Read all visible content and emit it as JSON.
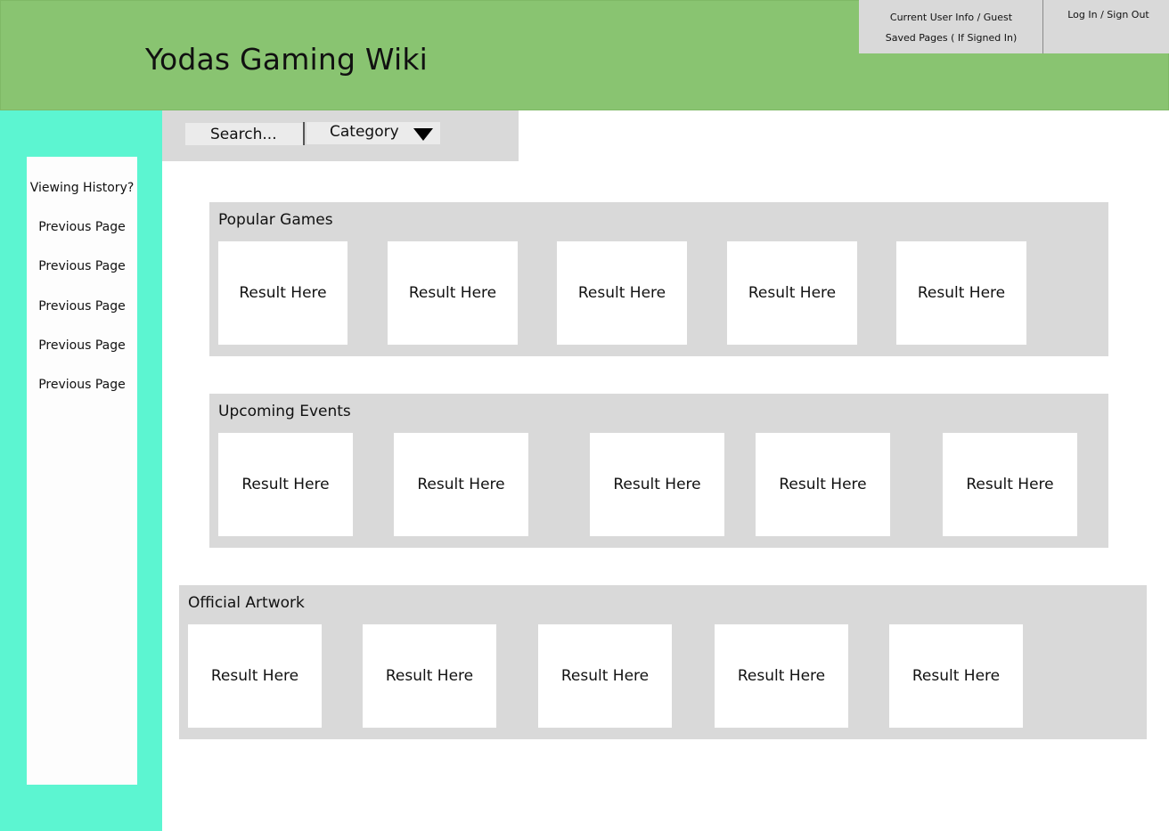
{
  "header": {
    "title": "Yodas Gaming Wiki",
    "user_info": "Current User Info / Guest",
    "saved_pages": "Saved Pages ( If Signed In)",
    "login": "Log In / Sign Out"
  },
  "sidebar": {
    "history_title": "Viewing History?",
    "items": [
      {
        "label": "Previous Page"
      },
      {
        "label": "Previous Page"
      },
      {
        "label": "Previous Page"
      },
      {
        "label": "Previous Page"
      },
      {
        "label": "Previous Page"
      }
    ]
  },
  "search": {
    "placeholder": "Search...",
    "category": "Category"
  },
  "sections": [
    {
      "title": "Popular Games",
      "cards": [
        "Result Here",
        "Result Here",
        "Result Here",
        "Result Here",
        "Result Here"
      ]
    },
    {
      "title": "Upcoming Events",
      "cards": [
        "Result Here",
        "Result Here",
        "Result Here",
        "Result Here",
        "Result Here"
      ]
    },
    {
      "title": "Official Artwork",
      "cards": [
        "Result Here",
        "Result Here",
        "Result Here",
        "Result Here",
        "Result Here"
      ]
    }
  ],
  "colors": {
    "header": "#89c471",
    "sidebar": "#5cf5d1",
    "panel": "#d9d9d9",
    "card": "#ffffff"
  }
}
